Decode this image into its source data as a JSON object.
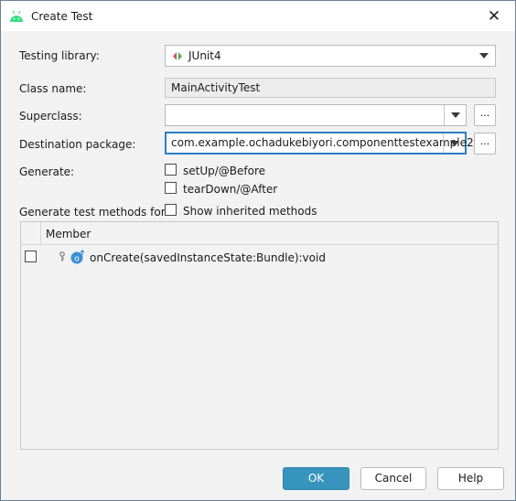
{
  "window": {
    "title": "Create Test",
    "app_icon": "android-icon",
    "close_glyph": "✕"
  },
  "form": {
    "testing_library": {
      "label": "Testing library:",
      "value": "JUnit4",
      "icon": "junit-icon"
    },
    "class_name": {
      "label": "Class name:",
      "value": "MainActivityTest"
    },
    "superclass": {
      "label": "Superclass:",
      "value": "",
      "browse_label": "..."
    },
    "destination_package": {
      "label": "Destination package:",
      "value": "com.example.ochadukebiyori.componenttestexample2",
      "browse_label": "..."
    },
    "generate": {
      "label": "Generate:",
      "options": [
        {
          "label": "setUp/@Before",
          "checked": false
        },
        {
          "label": "tearDown/@After",
          "checked": false
        }
      ]
    },
    "methods_for": {
      "label": "Generate test methods for:",
      "show_inherited_label": "Show inherited methods",
      "show_inherited_checked": false
    }
  },
  "members_table": {
    "header": "Member",
    "rows": [
      {
        "checked": false,
        "method": "onCreate(savedInstanceState:Bundle):void"
      }
    ]
  },
  "buttons": {
    "ok": "OK",
    "cancel": "Cancel",
    "help": "Help"
  },
  "colors": {
    "accent": "#3795bd",
    "focus_border": "#2d7fc4",
    "android_green": "#3ddc84",
    "method_icon": "#3d8fd6"
  }
}
